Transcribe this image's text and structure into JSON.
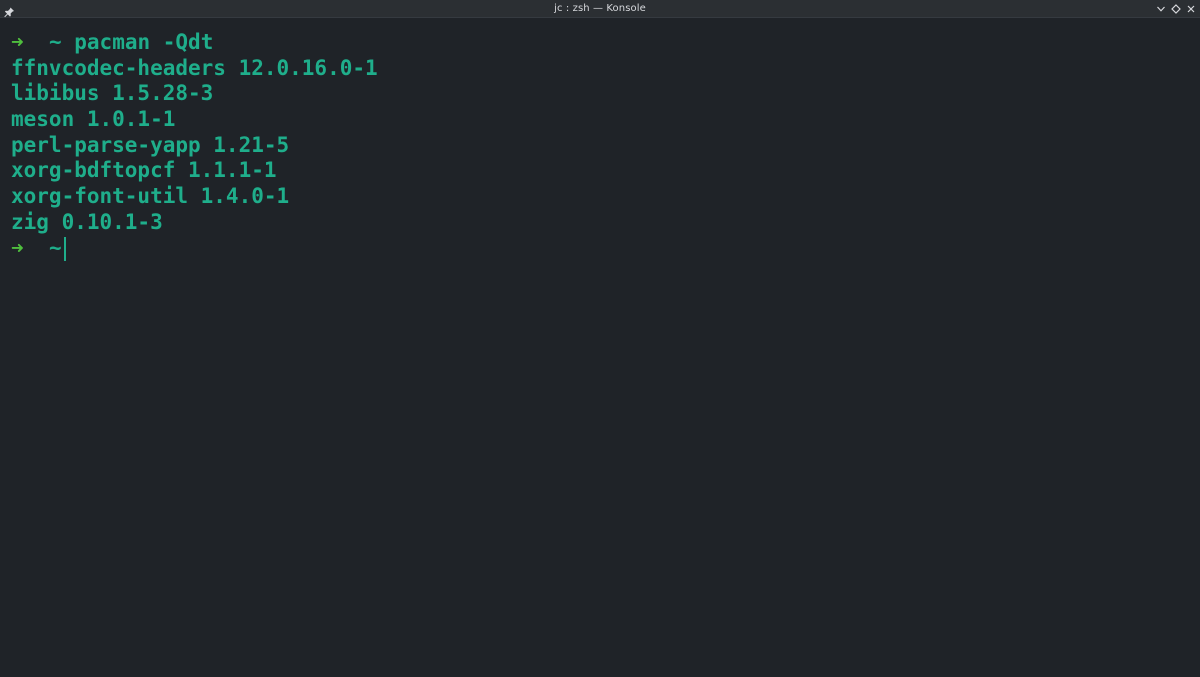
{
  "window": {
    "title": "jc : zsh — Konsole"
  },
  "icons": {
    "pin": "pin-icon",
    "minimize": "chevron-down-icon",
    "maximize": "diamond-icon",
    "close": "close-icon"
  },
  "colors": {
    "background": "#1f2328",
    "output": "#1fae8b",
    "prompt_arrow": "#4fbf3e"
  },
  "terminal": {
    "prompt_arrow": "➜",
    "prompt_dir": "~",
    "command": "pacman -Qdt",
    "output": [
      "ffnvcodec-headers 12.0.16.0-1",
      "libibus 1.5.28-3",
      "meson 1.0.1-1",
      "perl-parse-yapp 1.21-5",
      "xorg-bdftopcf 1.1.1-1",
      "xorg-font-util 1.4.0-1",
      "zig 0.10.1-3"
    ]
  }
}
